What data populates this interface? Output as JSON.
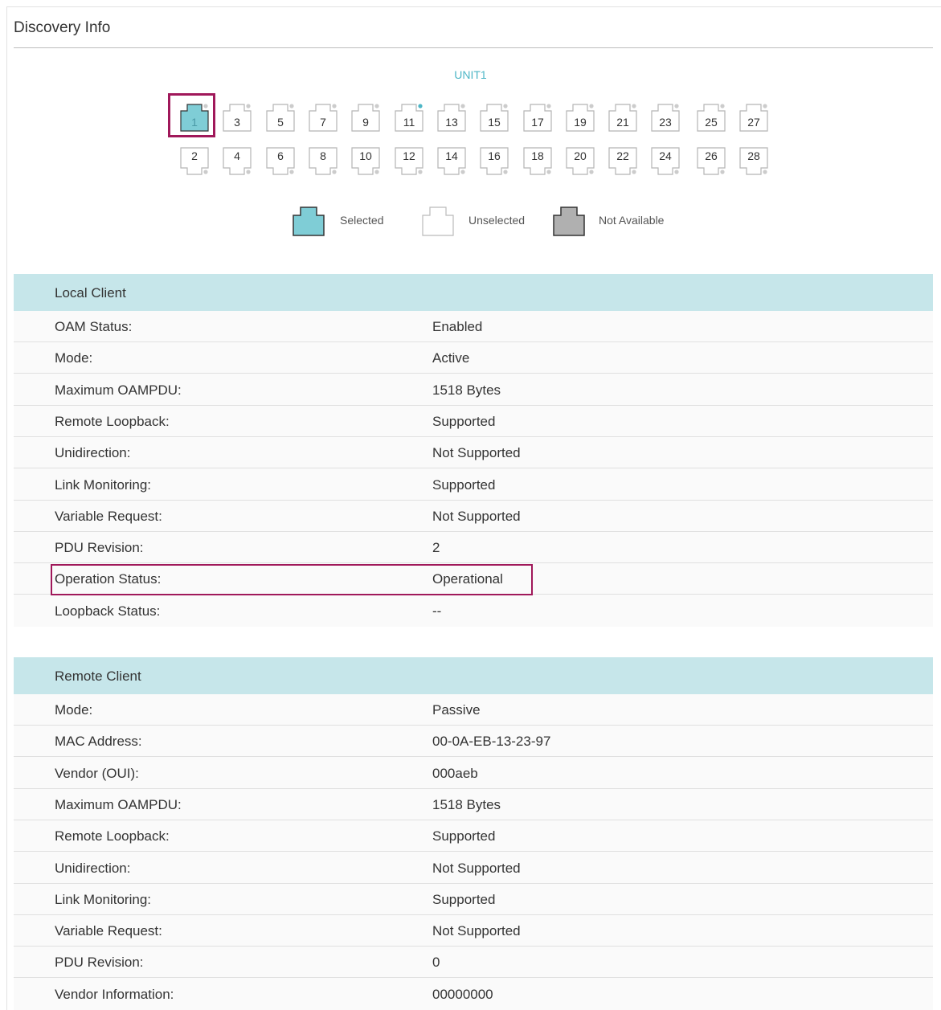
{
  "title": "Discovery Info",
  "unit_label": "UNIT1",
  "ports": {
    "top": [
      "1",
      "3",
      "5",
      "7",
      "9",
      "11",
      "13",
      "15",
      "17",
      "19",
      "21",
      "23",
      "25",
      "27"
    ],
    "bottom": [
      "2",
      "4",
      "6",
      "8",
      "10",
      "12",
      "14",
      "16",
      "18",
      "20",
      "22",
      "24",
      "26",
      "28"
    ],
    "selected": "1",
    "link_up": "11"
  },
  "legend": {
    "selected": "Selected",
    "unselected": "Unselected",
    "not_available": "Not Available"
  },
  "colors": {
    "selected": "#7fcdd6",
    "not_available": "#b0b0b0",
    "accent": "#4db6c6",
    "highlight": "#a0185a",
    "section_header": "#c6e6ea"
  },
  "local_client": {
    "header": "Local Client",
    "rows": [
      {
        "label": "OAM Status:",
        "value": "Enabled"
      },
      {
        "label": "Mode:",
        "value": "Active"
      },
      {
        "label": "Maximum OAMPDU:",
        "value": "1518 Bytes"
      },
      {
        "label": "Remote Loopback:",
        "value": "Supported"
      },
      {
        "label": "Unidirection:",
        "value": "Not Supported"
      },
      {
        "label": "Link Monitoring:",
        "value": "Supported"
      },
      {
        "label": "Variable Request:",
        "value": "Not Supported"
      },
      {
        "label": "PDU Revision:",
        "value": "2"
      },
      {
        "label": "Operation Status:",
        "value": "Operational"
      },
      {
        "label": "Loopback Status:",
        "value": "--"
      }
    ]
  },
  "remote_client": {
    "header": "Remote Client",
    "rows": [
      {
        "label": "Mode:",
        "value": "Passive"
      },
      {
        "label": "MAC Address:",
        "value": "00-0A-EB-13-23-97"
      },
      {
        "label": "Vendor (OUI):",
        "value": "000aeb"
      },
      {
        "label": "Maximum OAMPDU:",
        "value": "1518 Bytes"
      },
      {
        "label": "Remote Loopback:",
        "value": "Supported"
      },
      {
        "label": "Unidirection:",
        "value": "Not Supported"
      },
      {
        "label": "Link Monitoring:",
        "value": "Supported"
      },
      {
        "label": "Variable Request:",
        "value": "Not Supported"
      },
      {
        "label": "PDU Revision:",
        "value": "0"
      },
      {
        "label": "Vendor Information:",
        "value": "00000000"
      }
    ]
  }
}
